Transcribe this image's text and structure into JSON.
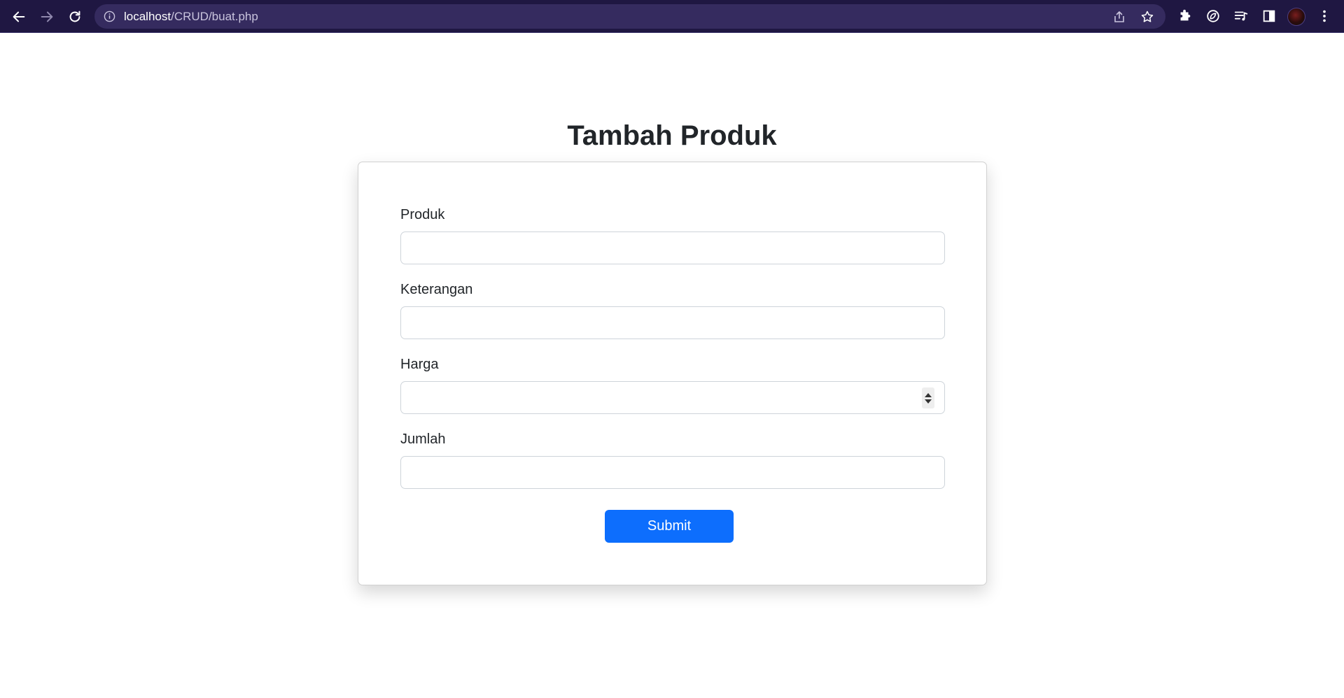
{
  "browser": {
    "url_host": "localhost",
    "url_path": "/CRUD/buat.php",
    "icons": {
      "back": "arrow-left-icon",
      "forward": "arrow-right-icon",
      "reload": "reload-icon",
      "site_info": "info-icon",
      "share": "share-icon",
      "bookmark": "star-icon",
      "extensions": "puzzle-icon",
      "extension": "leaf-icon",
      "reading_list": "media-list-icon",
      "side_panel": "side-panel-icon",
      "menu": "kebab-menu-icon"
    },
    "colors": {
      "toolbar": "#1f1742",
      "omnibox": "#352b5f"
    }
  },
  "page": {
    "title": "Tambah Produk",
    "form": {
      "fields": [
        {
          "label": "Produk",
          "value": "",
          "type": "text"
        },
        {
          "label": "Keterangan",
          "value": "",
          "type": "text"
        },
        {
          "label": "Harga",
          "value": "",
          "type": "number"
        },
        {
          "label": "Jumlah",
          "value": "",
          "type": "text"
        }
      ],
      "submit_label": "Submit"
    },
    "colors": {
      "primary": "#0d6efd",
      "text": "#212529",
      "input_border": "#ced4da"
    }
  }
}
